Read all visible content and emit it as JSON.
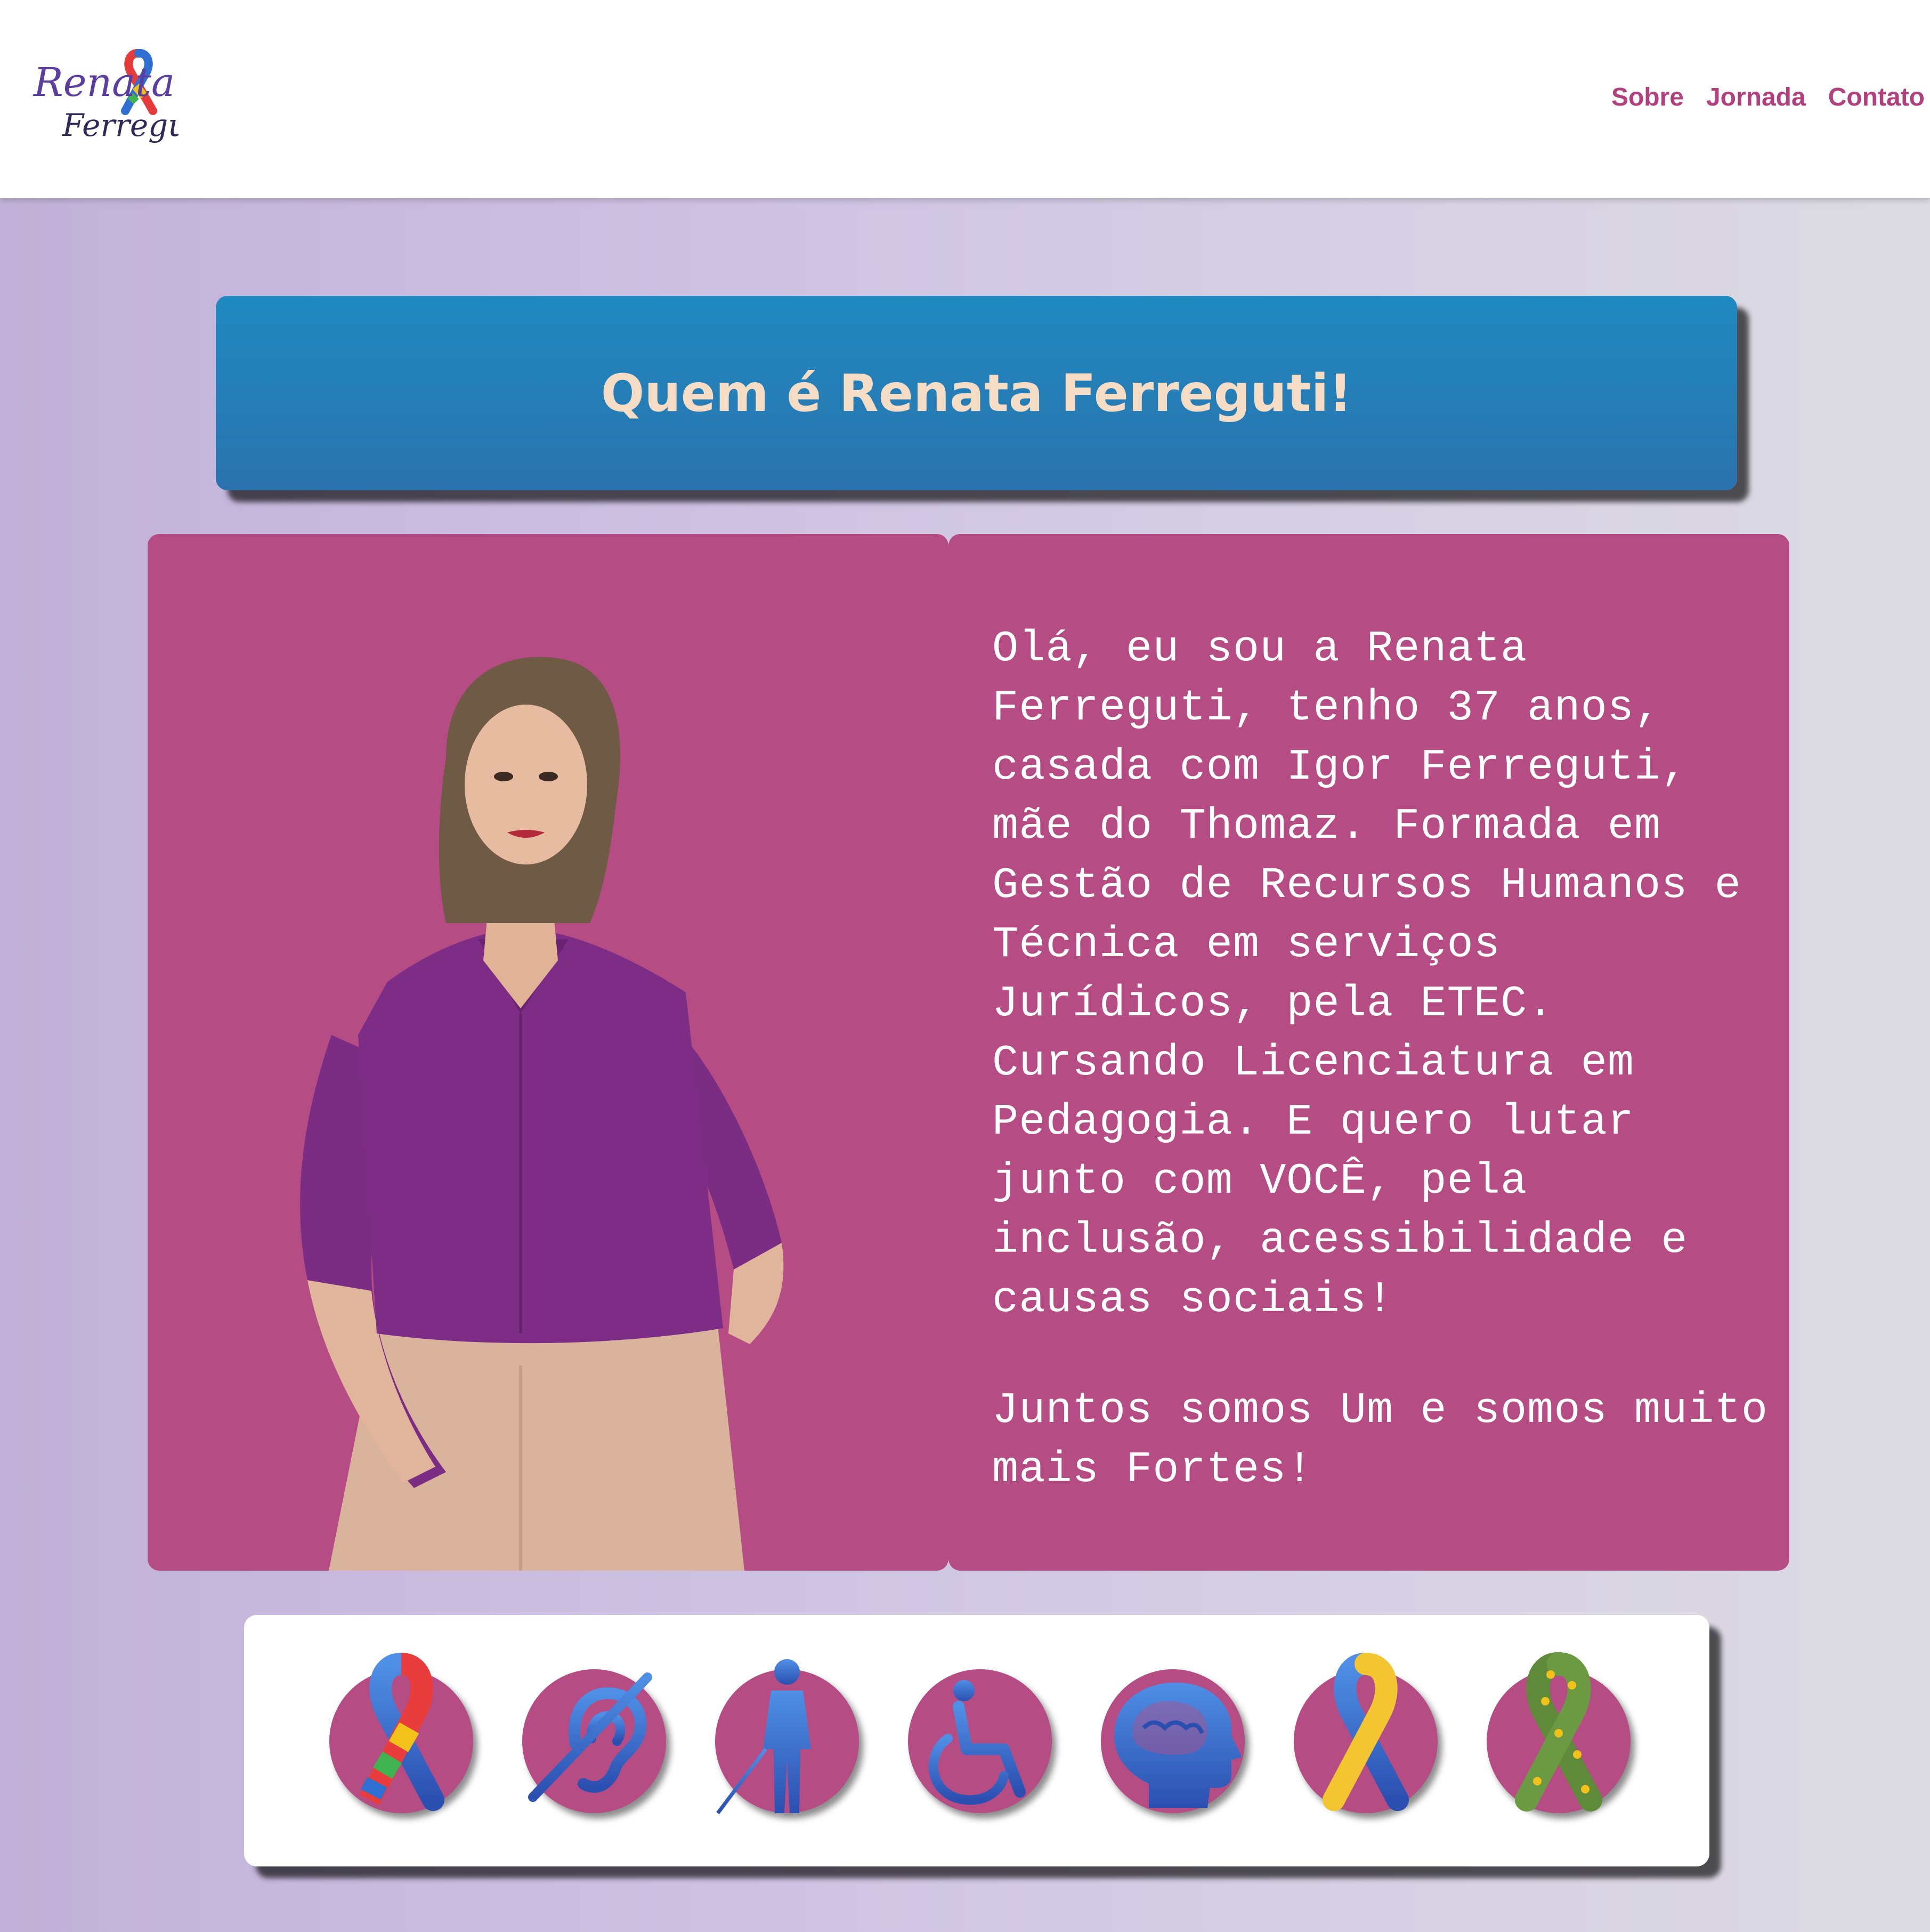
{
  "header": {
    "logo": {
      "line1": "Renata",
      "line2": "Ferreguti"
    },
    "nav": [
      {
        "label": "Sobre"
      },
      {
        "label": "Jornada"
      },
      {
        "label": "Contato"
      }
    ]
  },
  "hero": {
    "title": "Quem é Renata Ferreguti!"
  },
  "bio": {
    "paragraph1": "Olá, eu sou a Renata Ferreguti, tenho 37 anos, casada com Igor Ferreguti, mãe do Thomaz. Formada em Gestão de Recursos Humanos e Técnica em serviços Jurídicos, pela ETEC. Cursando Licenciatura em Pedagogia. E quero lutar junto com VOCÊ, pela inclusão, acessibilidade e causas sociais!",
    "paragraph2": "Juntos somos Um e somos muito mais Fortes!"
  },
  "causes": [
    {
      "icon": "autism-puzzle-ribbon-icon"
    },
    {
      "icon": "hearing-impairment-icon"
    },
    {
      "icon": "visual-impairment-icon"
    },
    {
      "icon": "wheelchair-icon"
    },
    {
      "icon": "mental-health-brain-icon"
    },
    {
      "icon": "down-syndrome-ribbon-icon"
    },
    {
      "icon": "sunflower-ribbon-icon"
    }
  ],
  "colors": {
    "brand_pink": "#b54d84",
    "nav_text": "#b0407e",
    "title_blue": "#2380b8",
    "title_text": "#f5dcc5",
    "icon_blue": "#3a7ccf"
  }
}
